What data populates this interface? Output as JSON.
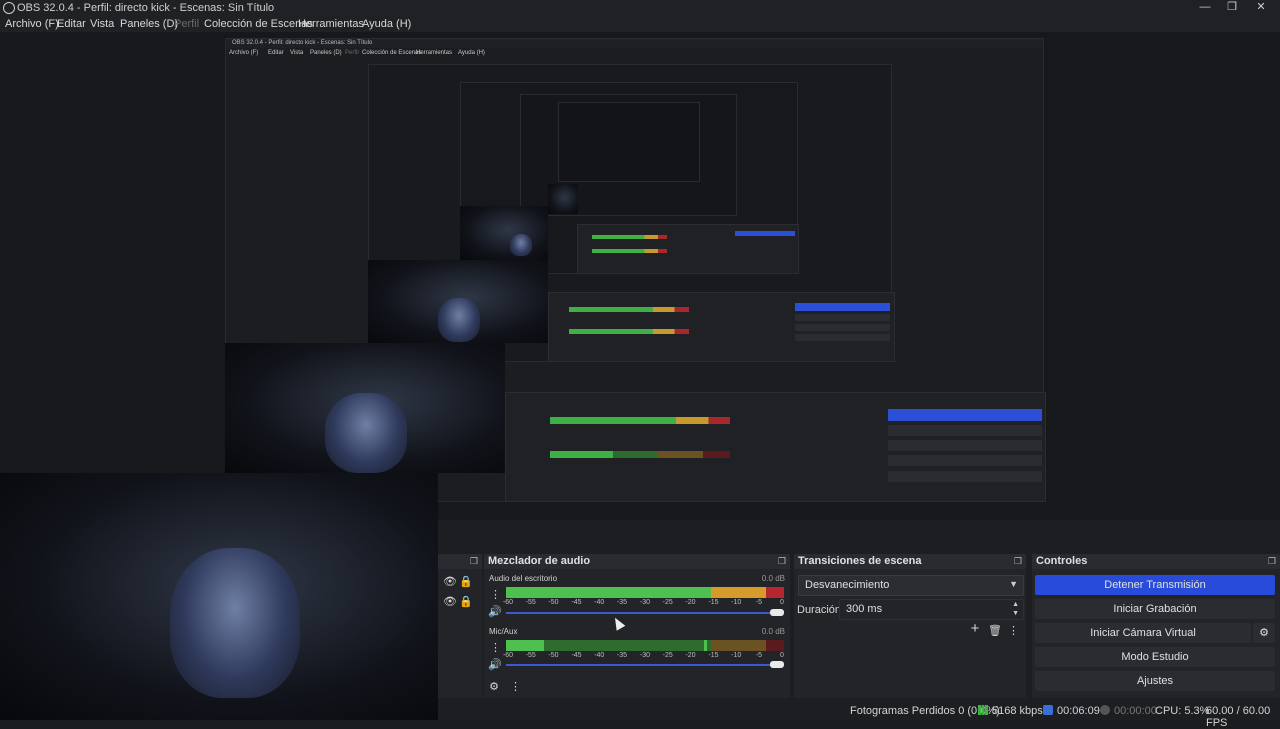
{
  "window": {
    "title": "OBS 32.0.4 - Perfil: directo kick - Escenas: Sin Título",
    "minimize": "—",
    "maximize": "❐",
    "close": "✕"
  },
  "menu": [
    {
      "label": "Archivo (F)"
    },
    {
      "label": "Editar"
    },
    {
      "label": "Vista"
    },
    {
      "label": "Paneles (D)"
    },
    {
      "label": "Perfil"
    },
    {
      "label": "Colección de Escenas"
    },
    {
      "label": "Herramientas"
    },
    {
      "label": "Ayuda (H)"
    }
  ],
  "nested": {
    "title": "OBS 32.0.4 - Perfil: directo kick - Escenas: Sin Título",
    "menu": [
      "Archivo (F)",
      "Editar",
      "Vista",
      "Paneles (D)",
      "Perfil",
      "Colección de Escenas",
      "Herramientas",
      "Ayuda (H)"
    ]
  },
  "mixer": {
    "title": "Mezclador de audio",
    "float_icon": "❐",
    "channels": [
      {
        "name": "Audio del escritorio",
        "db": "0.0 dB",
        "level": 0.9
      },
      {
        "name": "Mic/Aux",
        "db": "0.0 dB",
        "level": 0.14
      }
    ],
    "scale": [
      "-60",
      "-55",
      "-50",
      "-45",
      "-40",
      "-35",
      "-30",
      "-25",
      "-20",
      "-15",
      "-10",
      "-5",
      "0"
    ]
  },
  "transitions": {
    "title": "Transiciones de escena",
    "float_icon": "❐",
    "selected": "Desvanecimiento",
    "duration_label": "Duración",
    "duration_value": "300 ms",
    "add": "+",
    "remove": "🗑",
    "more": "⋮"
  },
  "controls": {
    "title": "Controles",
    "float_icon": "❐",
    "buttons": [
      {
        "label": "Detener Transmisión",
        "primary": true
      },
      {
        "label": "Iniciar Grabación"
      },
      {
        "label": "Iniciar Cámara Virtual"
      },
      {
        "label": "Modo Estudio"
      },
      {
        "label": "Ajustes"
      }
    ],
    "gear": "⚙"
  },
  "status": {
    "dropped_frames": "Fotogramas Perdidos 0 (0.0%)",
    "bitrate": "5168 kbps",
    "stream_time": "00:06:09",
    "rec_time": "00:00:00",
    "cpu": "CPU: 5.3%",
    "fps": "60.00 / 60.00 FPS"
  },
  "icons": {
    "eye": "eye-icon",
    "lock": "lock-icon",
    "speaker": "speaker-icon",
    "gear": "gear-icon"
  }
}
